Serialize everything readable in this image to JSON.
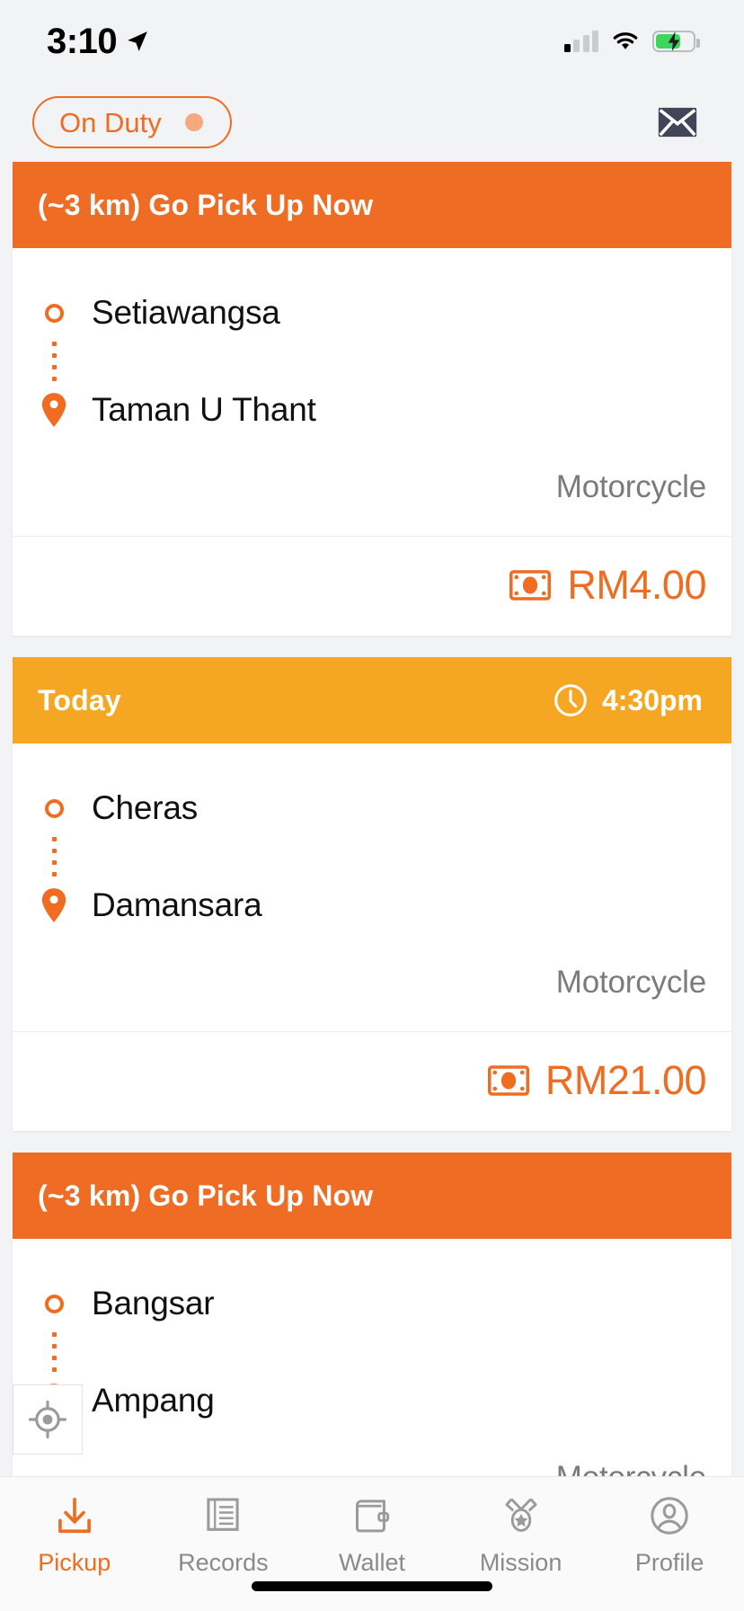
{
  "status_bar": {
    "time": "3:10",
    "location_icon": "location-arrow-icon",
    "signal_icon": "cellular-signal-icon",
    "signal_bars_filled": 1,
    "wifi_icon": "wifi-icon",
    "battery_icon": "battery-charging-icon",
    "battery_level_percent": 62,
    "battery_color": "#3cd65c"
  },
  "top_bar": {
    "duty_toggle_label": "On Duty",
    "duty_toggle_state": "on",
    "duty_accent_color": "#ef6c21",
    "mail_icon": "envelope-icon"
  },
  "theme": {
    "urgent_header_color": "#ee6c24",
    "scheduled_header_color": "#f5a623",
    "accent_color": "#ef6c21",
    "page_background": "#f2f3f5"
  },
  "orders": [
    {
      "header_type": "urgent",
      "header_title": "(~3 km) Go Pick Up Now",
      "pickup": "Setiawangsa",
      "dropoff": "Taman U Thant",
      "vehicle": "Motorcycle",
      "price": "RM4.00",
      "price_icon": "banknote-icon"
    },
    {
      "header_type": "scheduled",
      "header_title": "Today",
      "header_time": "4:30pm",
      "clock_icon": "clock-icon",
      "pickup": "Cheras",
      "dropoff": "Damansara",
      "vehicle": "Motorcycle",
      "price": "RM21.00",
      "price_icon": "banknote-icon"
    },
    {
      "header_type": "urgent",
      "header_title": "(~3 km) Go Pick Up Now",
      "pickup": "Bangsar",
      "dropoff": "Ampang",
      "vehicle": "Motorcycle",
      "price": "",
      "price_icon": "banknote-icon"
    }
  ],
  "gps_button": {
    "icon": "crosshair-location-icon"
  },
  "tab_bar": {
    "items": [
      {
        "label": "Pickup",
        "icon": "download-arrow-icon",
        "active": true
      },
      {
        "label": "Records",
        "icon": "document-lines-icon",
        "active": false
      },
      {
        "label": "Wallet",
        "icon": "wallet-icon",
        "active": false
      },
      {
        "label": "Mission",
        "icon": "medal-star-icon",
        "active": false
      },
      {
        "label": "Profile",
        "icon": "user-circle-icon",
        "active": false
      }
    ]
  }
}
